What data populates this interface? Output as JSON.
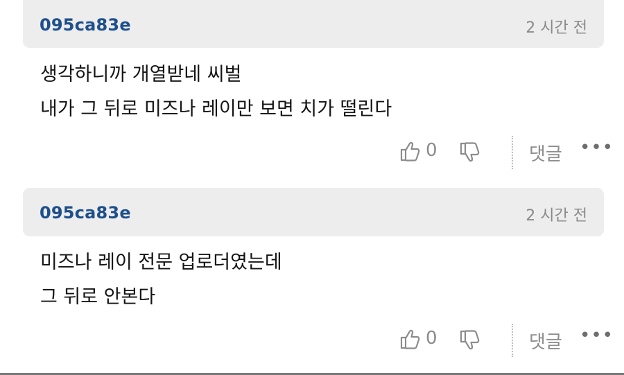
{
  "comments": [
    {
      "author": "095ca83e",
      "time": "2 시간 전",
      "lines": [
        "생각하니까 개열받네 씨벌",
        "내가 그 뒤로 미즈나 레이만 보면 치가 떨린다"
      ],
      "likes": "0",
      "reply_label": "댓글",
      "more_label": "•••"
    },
    {
      "author": "095ca83e",
      "time": "2 시간 전",
      "lines": [
        "미즈나 레이 전문 업로더였는데",
        "그 뒤로 안본다"
      ],
      "likes": "0",
      "reply_label": "댓글",
      "more_label": "•••"
    }
  ],
  "icons": {
    "like": "thumbs-up-icon",
    "dislike": "thumbs-down-icon",
    "more": "more-icon"
  },
  "colors": {
    "author": "#1d4f8c",
    "header_bg": "#ededed",
    "muted": "#8c8c8c"
  }
}
